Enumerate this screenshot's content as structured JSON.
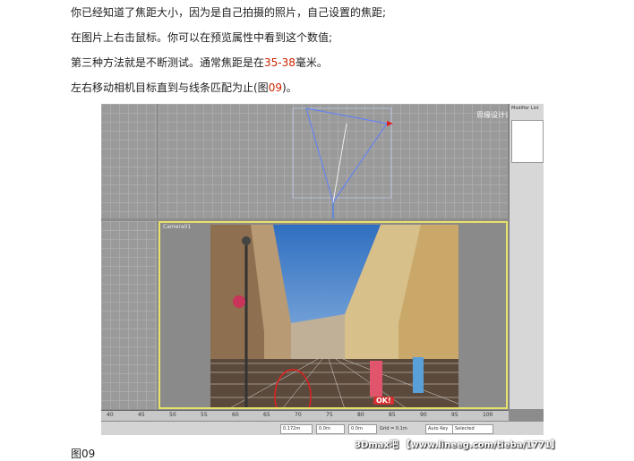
{
  "paragraphs": [
    {
      "text": "你已经知道了焦距大小，因为是自己拍摄的照片，自己设置的焦距;"
    },
    {
      "text": "在图片上右击鼠标。你可以在预览属性中看到这个数值;"
    },
    {
      "pre": "第三种方法就是不断测试。通常焦距是在",
      "highlight": "35-38",
      "post": "毫米。"
    },
    {
      "pre": "左右移动相机目标直到与线条匹配为止(图",
      "highlight": "09",
      "post": ")。"
    }
  ],
  "screenshot": {
    "watermark": "思缘设计论坛 www.MISSYUAN.COM",
    "camera_label": "Camera01",
    "panel_title": "Modifier List",
    "ok_label": "OK!",
    "timeline_ticks": [
      "40",
      "45",
      "50",
      "55",
      "60",
      "65",
      "70",
      "75",
      "80",
      "85",
      "90",
      "95",
      "100"
    ],
    "status": {
      "x": "0.172m",
      "y": "0.0m",
      "z": "0.0m",
      "grid": "Grid = 0.1m",
      "auto_key": "Auto Key",
      "selected": "Selected"
    }
  },
  "caption": "图09",
  "footer_watermark": "3Dmax吧 【www.lineeg.com/tieba/1771】",
  "colors": {
    "highlight": "#cc2200",
    "camera_border": "#e7e26a",
    "ok_tag": "#d43030"
  }
}
